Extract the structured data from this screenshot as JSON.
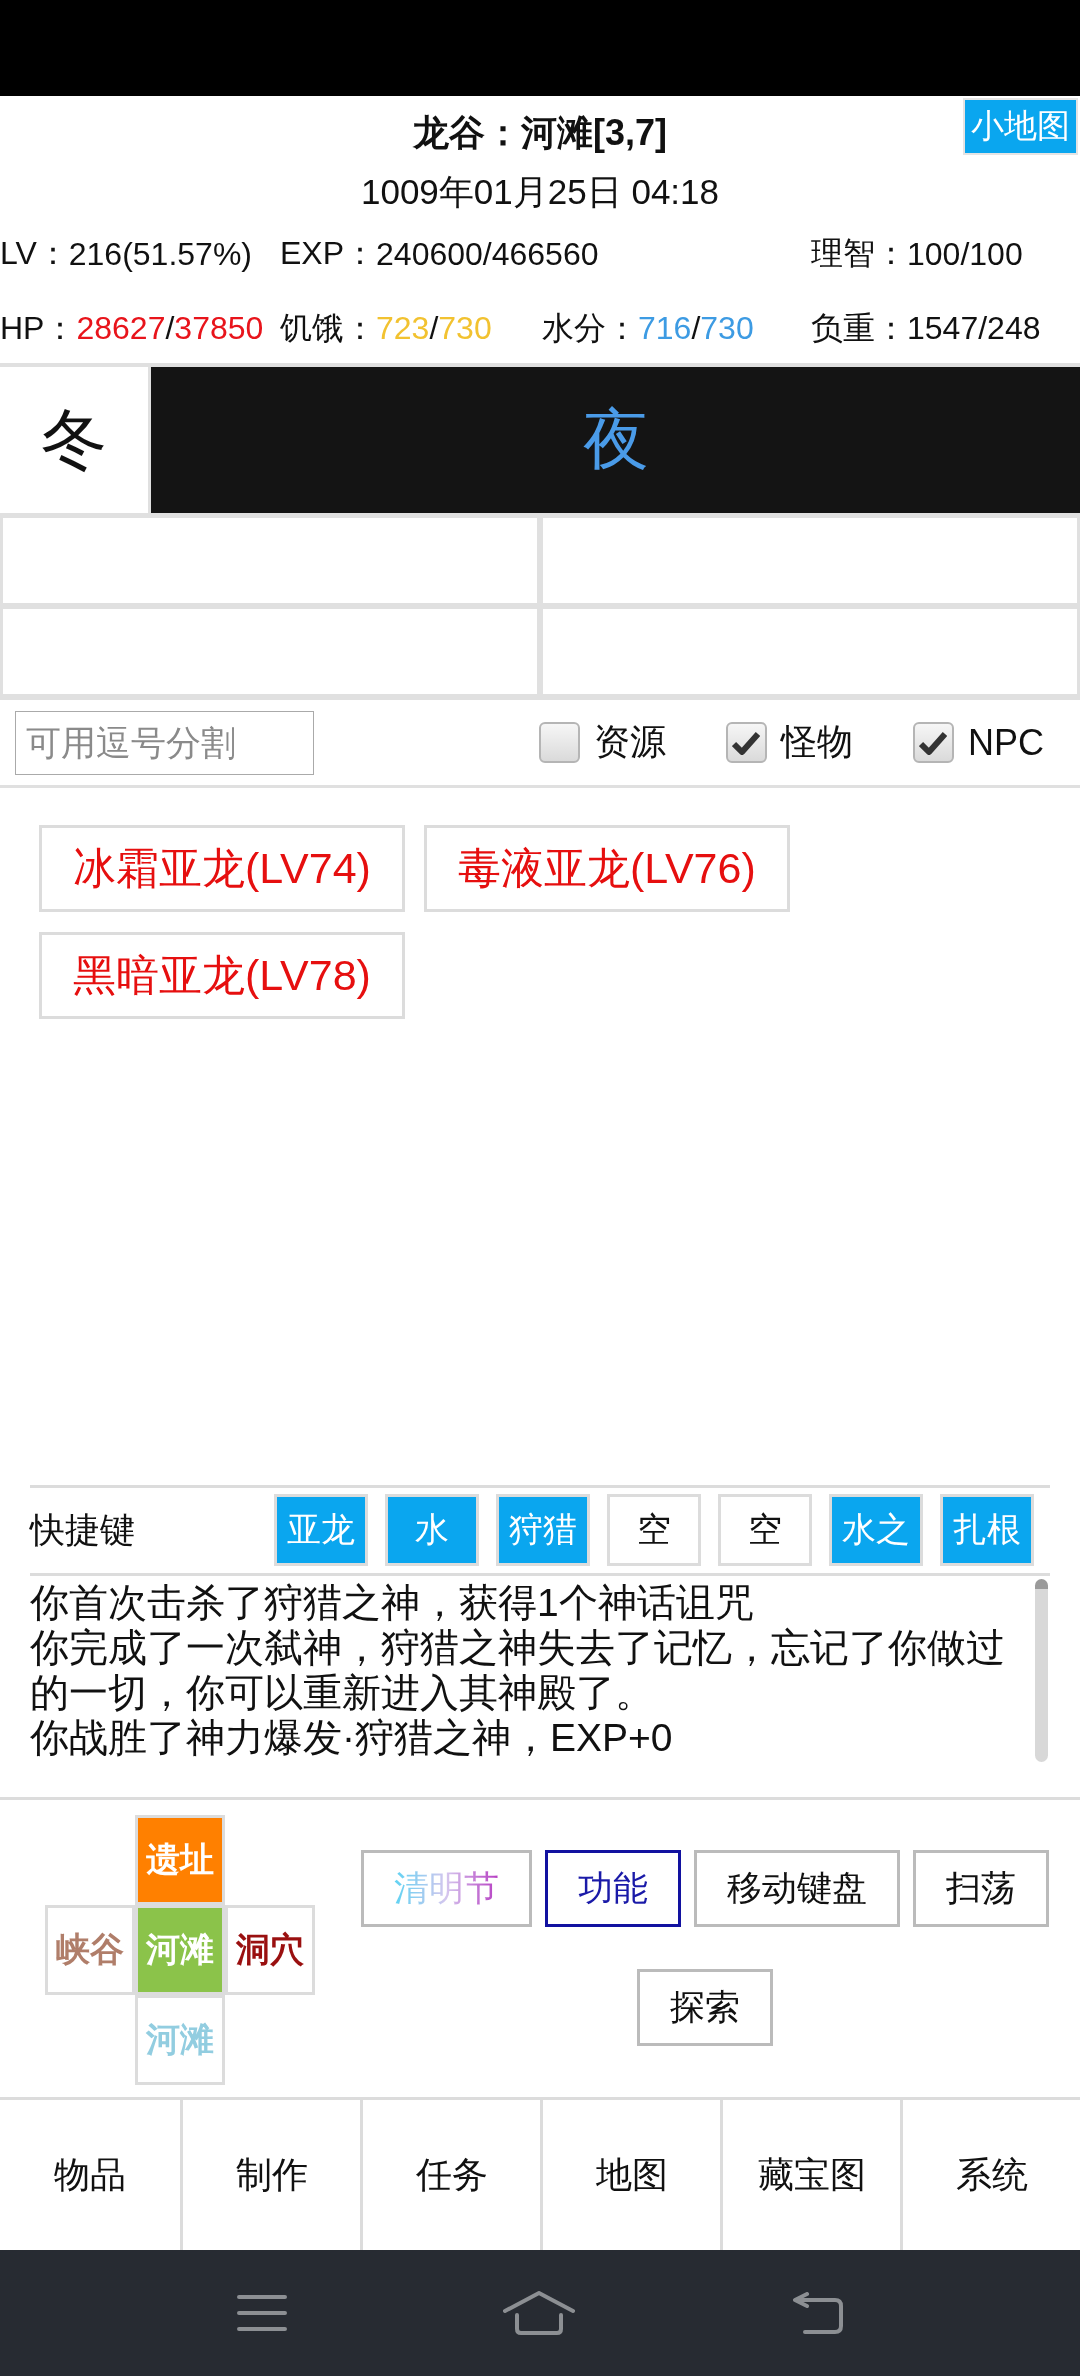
{
  "header": {
    "title": "龙谷：河滩[3,7]",
    "minimap_button": "小地图",
    "datetime": "1009年01月25日 04:18"
  },
  "stats": [
    [
      {
        "label": "LV：",
        "value": "216(51.57%)"
      },
      {
        "label": "EXP：",
        "value": "240600/466560"
      },
      {
        "label": "理智：",
        "value": "100/100"
      }
    ],
    [
      {
        "label": "HP：",
        "current": "28627",
        "separator": "/",
        "max": "37850",
        "color": "#e8141b"
      },
      {
        "label": "饥饿：",
        "current": "723",
        "separator": "/",
        "max": "730",
        "color": "#f2c230"
      },
      {
        "label": "水分：",
        "current": "716",
        "separator": "/",
        "max": "730",
        "color": "#3d9be3"
      },
      {
        "label": "负重：",
        "value": "1547/248"
      }
    ]
  ],
  "season": "冬",
  "time_of_day": "夜",
  "filter": {
    "placeholder": "可用逗号分割",
    "options": [
      {
        "label": "资源",
        "checked": false
      },
      {
        "label": "怪物",
        "checked": true
      },
      {
        "label": "NPC",
        "checked": true
      }
    ]
  },
  "monsters": [
    "冰霜亚龙(LV74)",
    "毒液亚龙(LV76)",
    "黑暗亚龙(LV78)"
  ],
  "shortcuts": {
    "label": "快捷键",
    "keys": [
      {
        "label": "亚龙",
        "assigned": true
      },
      {
        "label": "水",
        "assigned": true
      },
      {
        "label": "狩猎",
        "assigned": true
      },
      {
        "label": "空",
        "assigned": false
      },
      {
        "label": "空",
        "assigned": false
      },
      {
        "label": "水之",
        "assigned": true
      },
      {
        "label": "扎根",
        "assigned": true
      }
    ]
  },
  "log": [
    "你首次击杀了狩猎之神，获得1个神话诅咒",
    "你完成了一次弑神，狩猎之神失去了记忆，忘记了你做过的一切，你可以重新进入其神殿了。",
    "你战胜了神力爆发·狩猎之神，EXP+0"
  ],
  "map": {
    "north": {
      "name": "遗址",
      "color": "#ff8000",
      "filled": true
    },
    "west": {
      "name": "峡谷",
      "color": "#b07e6a",
      "filled": false
    },
    "center": {
      "name": "河滩",
      "color": "#8bc34a",
      "filled": true
    },
    "east": {
      "name": "洞穴",
      "color": "#9a1010",
      "filled": false
    },
    "south": {
      "name": "河滩",
      "color": "#92cde0",
      "filled": false
    }
  },
  "actions": [
    {
      "label": "清明节",
      "kind": "festival"
    },
    {
      "label": "功能",
      "kind": "primary"
    },
    {
      "label": "移动键盘",
      "kind": "plain"
    },
    {
      "label": "扫荡",
      "kind": "plain"
    },
    {
      "label": "探索",
      "kind": "plain"
    }
  ],
  "bottom_nav": [
    "物品",
    "制作",
    "任务",
    "地图",
    "藏宝图",
    "系统"
  ]
}
